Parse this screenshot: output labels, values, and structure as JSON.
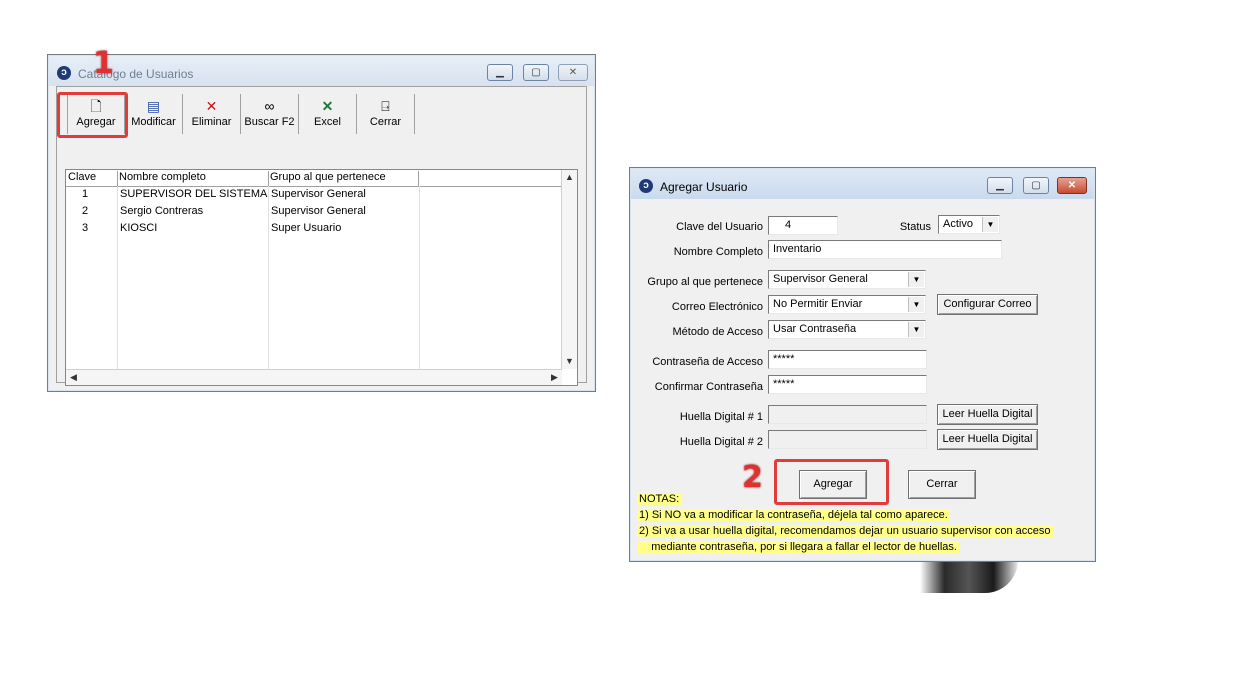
{
  "catalog_window": {
    "title": "Catálogo de Usuarios",
    "toolbar": [
      {
        "label": "Agregar",
        "icon": "new-document-icon"
      },
      {
        "label": "Modificar",
        "icon": "edit-icon"
      },
      {
        "label": "Eliminar",
        "icon": "delete-x-icon"
      },
      {
        "label": "Buscar F2",
        "icon": "binoculars-icon"
      },
      {
        "label": "Excel",
        "icon": "excel-icon"
      },
      {
        "label": "Cerrar",
        "icon": "exit-door-icon"
      }
    ],
    "grid": {
      "columns": [
        "Clave",
        "Nombre completo",
        "Grupo al que pertenece"
      ],
      "rows": [
        {
          "clave": "1",
          "nombre": "SUPERVISOR DEL SISTEMA",
          "grupo": "Supervisor General"
        },
        {
          "clave": "2",
          "nombre": "Sergio Contreras",
          "grupo": "Supervisor General"
        },
        {
          "clave": "3",
          "nombre": "KIOSCI",
          "grupo": "Super Usuario"
        }
      ]
    }
  },
  "annotations": {
    "step1": "1",
    "step2": "2",
    "highlight_color": "#e23b3b"
  },
  "add_user_window": {
    "title": "Agregar Usuario",
    "clave_label": "Clave del Usuario",
    "clave_value": "4",
    "status_label": "Status",
    "status_value": "Activo",
    "nombre_label": "Nombre Completo",
    "nombre_value": "Inventario",
    "grupo_label": "Grupo al que pertenece",
    "grupo_value": "Supervisor General",
    "correo_label": "Correo Electrónico",
    "correo_value": "No Permitir Enviar",
    "configurar_correo_button": "Configurar Correo",
    "metodo_label": "Método de Acceso",
    "metodo_value": "Usar Contraseña",
    "contrasena_label": "Contraseña de Acceso",
    "contrasena_value": "*****",
    "confirmar_label": "Confirmar Contraseña",
    "confirmar_value": "*****",
    "huella1_label": "Huella Digital # 1",
    "huella2_label": "Huella Digital # 2",
    "leer_huella_button": "Leer Huella Digital",
    "agregar_button": "Agregar",
    "cerrar_button": "Cerrar",
    "notes": [
      "NOTAS:",
      "1) Si NO va a modificar la contraseña, déjela tal como aparece.",
      "2) Si va a usar huella digital, recomendamos dejar un usuario supervisor con acceso",
      "    mediante contraseña, por si llegara a fallar el lector de huellas."
    ]
  },
  "window_buttons": {
    "minimize": "▭",
    "maximize": "□",
    "close": "✕"
  }
}
